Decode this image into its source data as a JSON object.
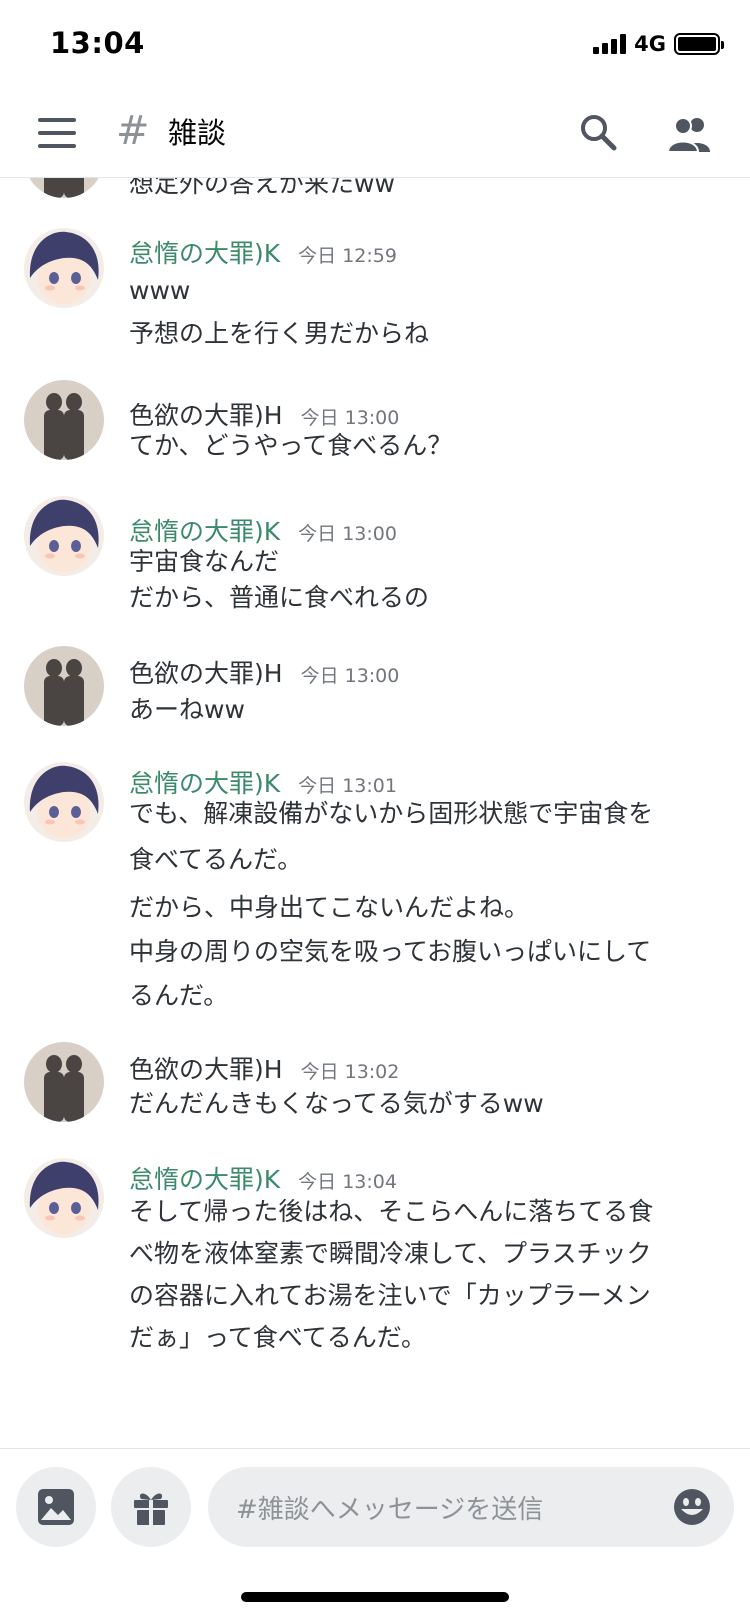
{
  "status": {
    "time": "13:04",
    "network": "4G"
  },
  "header": {
    "channel_name": "雑談"
  },
  "partial_message": {
    "text": "想定外の答えが来たww"
  },
  "users": {
    "k": {
      "name": "怠惰の大罪)K",
      "color": "#3c8a6b"
    },
    "h": {
      "name": "色欲の大罪)H",
      "color": "#2e3338"
    }
  },
  "messages": [
    {
      "author": "怠惰の大罪)K",
      "timestamp": "今日 12:59",
      "lines": [
        "www",
        "予想の上を行く男だからね"
      ]
    },
    {
      "author": "色欲の大罪)H",
      "timestamp": "今日 13:00",
      "lines": [
        "てか、どうやって食べるん？"
      ]
    },
    {
      "author": "怠惰の大罪)K",
      "timestamp": "今日 13:00",
      "lines": [
        "宇宙食なんだ",
        "だから、普通に食べれるの"
      ]
    },
    {
      "author": "色欲の大罪)H",
      "timestamp": "今日 13:00",
      "lines": [
        "あーねww"
      ]
    },
    {
      "author": "怠惰の大罪)K",
      "timestamp": "今日 13:01",
      "lines": [
        "でも、解凍設備がないから固形状態で宇宙食を",
        "食べてるんだ。",
        "だから、中身出てこないんだよね。",
        "中身の周りの空気を吸ってお腹いっぱいにして",
        "るんだ。"
      ]
    },
    {
      "author": "色欲の大罪)H",
      "timestamp": "今日 13:02",
      "lines": [
        "だんだんきもくなってる気がするww"
      ]
    },
    {
      "author": "怠惰の大罪)K",
      "timestamp": "今日 13:04",
      "lines": [
        "そして帰った後はね、そこらへんに落ちてる食",
        "べ物を液体窒素で瞬間冷凍して、プラスチック",
        "の容器に入れてお湯を注いで「カップラーメン",
        "だぁ」って食べてるんだ。"
      ]
    }
  ],
  "composer": {
    "placeholder": "#雑談へメッセージを送信"
  },
  "icons": {
    "menu": "menu-icon",
    "channel": "hash-icon",
    "search": "search-icon",
    "members": "members-icon",
    "image": "image-icon",
    "gift": "gift-icon",
    "emoji": "emoji-icon"
  }
}
